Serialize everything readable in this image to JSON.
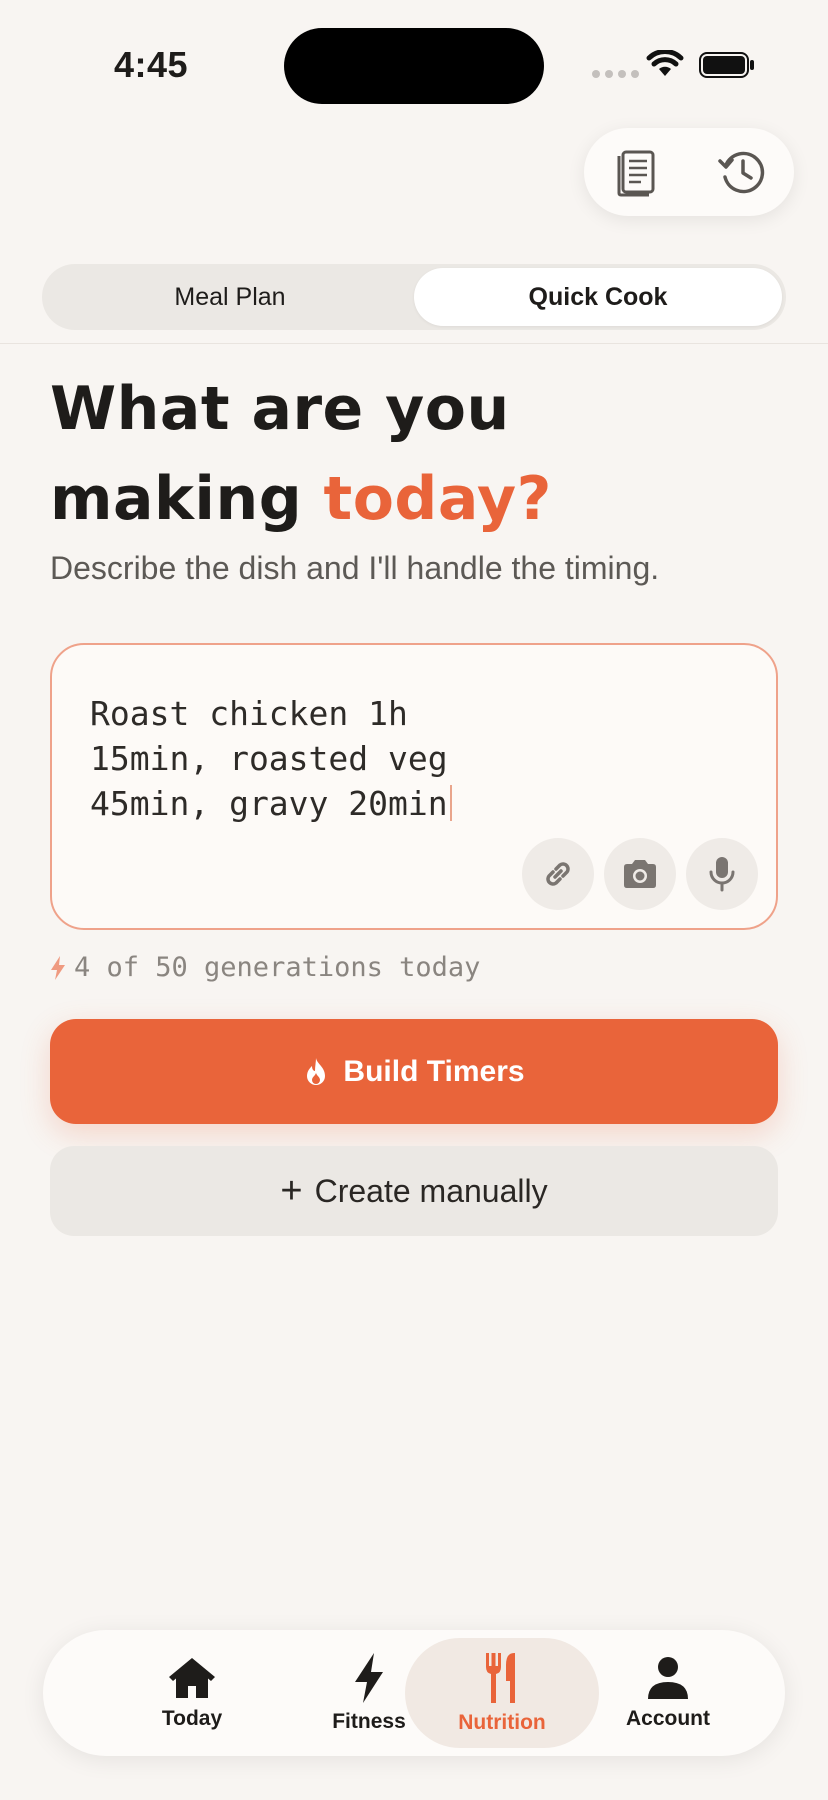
{
  "status_bar": {
    "time": "4:45"
  },
  "segmented": {
    "tabs": [
      {
        "label": "Meal Plan",
        "active": false
      },
      {
        "label": "Quick Cook",
        "active": true
      }
    ]
  },
  "headline": {
    "part1": "What are you making ",
    "accent": "today?"
  },
  "subtitle": "Describe the dish and I'll handle the timing.",
  "input": {
    "value": "Roast chicken 1h 15min, roasted veg 45min, gravy 20min"
  },
  "usage": "4 of 50 generations today",
  "build_button": "Build Timers",
  "manual_button": {
    "icon": "+",
    "label": "Create manually"
  },
  "tab_bar": {
    "today": "Today",
    "fitness": "Fitness",
    "nutrition": "Nutrition",
    "account": "Account",
    "active": "Nutrition"
  },
  "colors": {
    "accent": "#e9643a",
    "background": "#f8f5f2",
    "input_border": "#efa28a"
  }
}
